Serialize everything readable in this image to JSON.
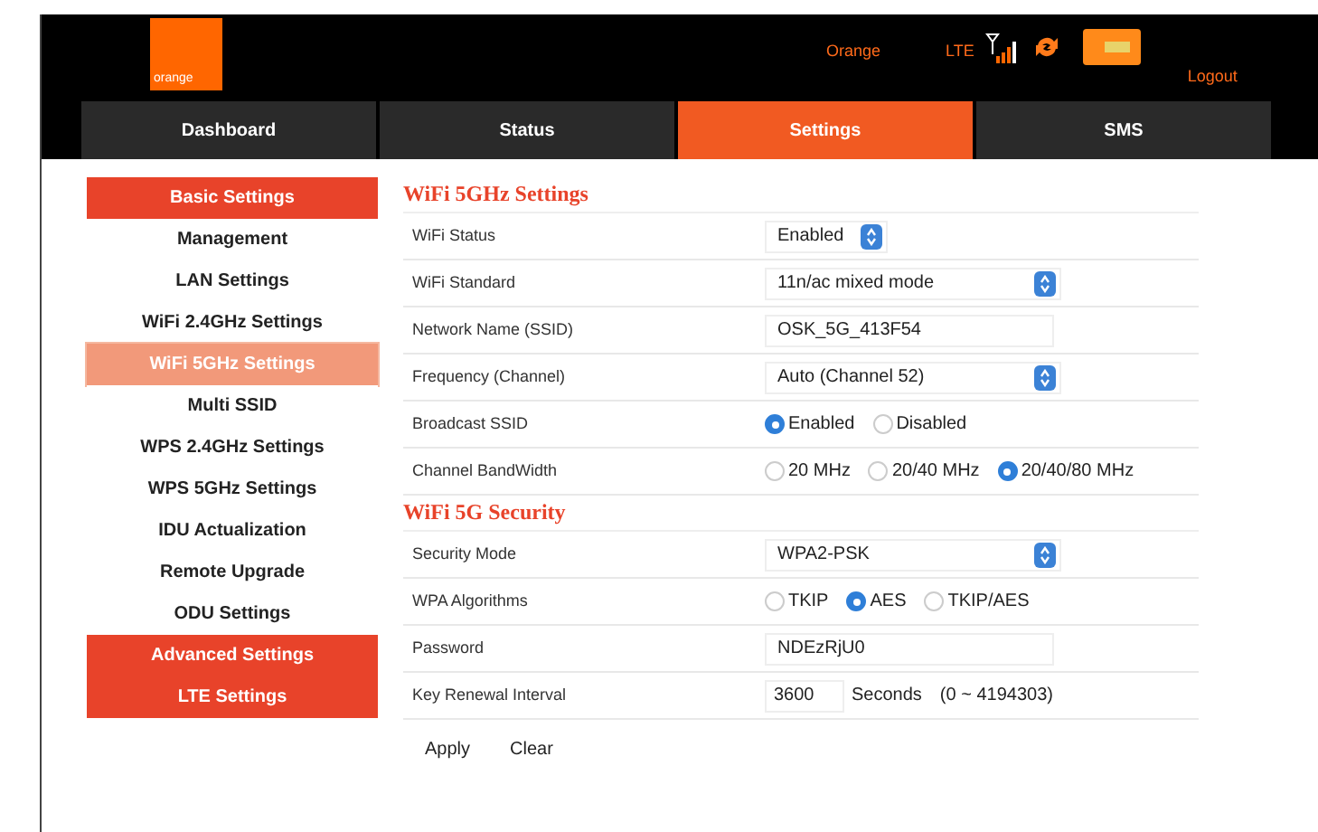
{
  "header": {
    "logo": "orange",
    "operator": "Orange",
    "network": "LTE",
    "logout": "Logout"
  },
  "tabs": [
    {
      "label": "Dashboard",
      "selected": false
    },
    {
      "label": "Status",
      "selected": false
    },
    {
      "label": "Settings",
      "selected": true
    },
    {
      "label": "SMS",
      "selected": false
    }
  ],
  "sidebar": [
    {
      "label": "Basic Settings",
      "kind": "header",
      "selected": false
    },
    {
      "label": "Management",
      "kind": "link",
      "selected": false
    },
    {
      "label": "LAN Settings",
      "kind": "link",
      "selected": false
    },
    {
      "label": "WiFi 2.4GHz Settings",
      "kind": "link",
      "selected": false
    },
    {
      "label": "WiFi 5GHz Settings",
      "kind": "link",
      "selected": true
    },
    {
      "label": "Multi SSID",
      "kind": "link",
      "selected": false
    },
    {
      "label": "WPS 2.4GHz Settings",
      "kind": "link",
      "selected": false
    },
    {
      "label": "WPS 5GHz Settings",
      "kind": "link",
      "selected": false
    },
    {
      "label": "IDU Actualization",
      "kind": "link",
      "selected": false
    },
    {
      "label": "Remote Upgrade",
      "kind": "link",
      "selected": false
    },
    {
      "label": "ODU Settings",
      "kind": "link",
      "selected": false
    },
    {
      "label": "Advanced Settings",
      "kind": "header",
      "selected": false
    },
    {
      "label": "LTE Settings",
      "kind": "header",
      "selected": false
    }
  ],
  "sections": [
    {
      "title": "WiFi 5GHz Settings",
      "rows": [
        {
          "label": "WiFi Status",
          "kind": "toggle_select",
          "value": "Enabled"
        },
        {
          "label": "WiFi Standard",
          "kind": "select",
          "value": "11n/ac mixed mode"
        },
        {
          "label": "Network Name (SSID)",
          "kind": "text",
          "value": "OSK_5G_413F54"
        },
        {
          "label": "Frequency (Channel)",
          "kind": "select",
          "value": "Auto (Channel 52)"
        },
        {
          "label": "Broadcast SSID",
          "kind": "radio",
          "options": [
            {
              "label": "Enabled",
              "selected": true
            },
            {
              "label": "Disabled",
              "selected": false
            }
          ]
        },
        {
          "label": "Channel BandWidth",
          "kind": "radio",
          "options": [
            {
              "label": "20 MHz",
              "selected": false
            },
            {
              "label": "20/40 MHz",
              "selected": false
            },
            {
              "label": "20/40/80 MHz",
              "selected": true
            }
          ]
        }
      ]
    },
    {
      "title": "WiFi 5G Security",
      "rows": [
        {
          "label": "Security Mode",
          "kind": "select",
          "value": "WPA2-PSK"
        },
        {
          "label": "WPA Algorithms",
          "kind": "radio",
          "options": [
            {
              "label": "TKIP",
              "selected": false
            },
            {
              "label": "AES",
              "selected": true
            },
            {
              "label": "TKIP/AES",
              "selected": false
            }
          ]
        },
        {
          "label": "Password",
          "kind": "text",
          "value": "NDEzRjU0"
        },
        {
          "label": "Key Renewal Interval",
          "kind": "number",
          "value": "3600",
          "unit": "Seconds",
          "range": "(0 ~ 4194303)"
        }
      ]
    }
  ],
  "buttons": [
    "Apply",
    "Clear"
  ]
}
